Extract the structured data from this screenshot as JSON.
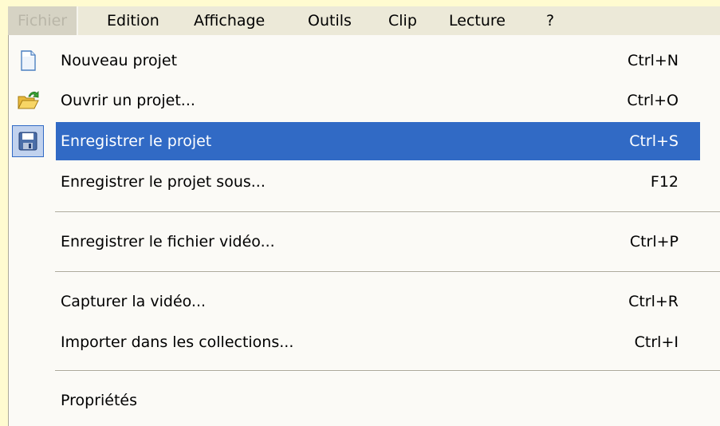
{
  "menubar": {
    "items": [
      {
        "label": "Fichier",
        "active": true
      },
      {
        "label": "Edition"
      },
      {
        "label": "Affichage"
      },
      {
        "label": "Outils"
      },
      {
        "label": "Clip"
      },
      {
        "label": "Lecture"
      },
      {
        "label": "?"
      }
    ]
  },
  "file_menu": {
    "items": [
      {
        "label": "Nouveau projet",
        "shortcut": "Ctrl+N",
        "icon": "new-document-icon"
      },
      {
        "label": "Ouvrir un projet...",
        "shortcut": "Ctrl+O",
        "icon": "open-folder-icon"
      },
      {
        "label": "Enregistrer le projet",
        "shortcut": "Ctrl+S",
        "icon": "floppy-disk-icon",
        "selected": true
      },
      {
        "label": "Enregistrer le projet sous...",
        "shortcut": "F12"
      },
      {
        "label": "Enregistrer le fichier vidéo...",
        "shortcut": "Ctrl+P"
      },
      {
        "label": "Capturer la vidéo...",
        "shortcut": "Ctrl+R"
      },
      {
        "label": "Importer dans les collections...",
        "shortcut": "Ctrl+I"
      },
      {
        "label": "Propriétés",
        "shortcut": ""
      }
    ]
  },
  "colors": {
    "selection": "#316ac5",
    "menubar_bg": "#ece9d8",
    "menu_bg": "#fbfaf6",
    "page_bg": "#fffbd0"
  }
}
